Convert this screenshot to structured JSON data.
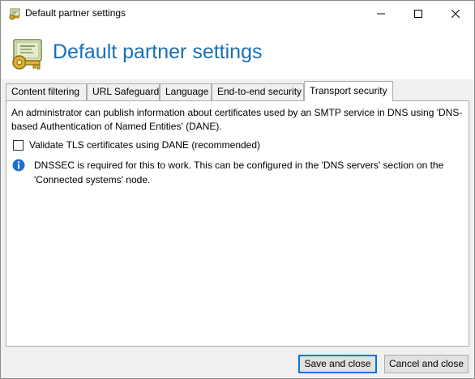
{
  "window": {
    "title": "Default partner settings"
  },
  "header": {
    "title": "Default partner settings"
  },
  "tabs": [
    {
      "label": "Content filtering",
      "active": false
    },
    {
      "label": "URL Safeguard",
      "active": false
    },
    {
      "label": "Language",
      "active": false
    },
    {
      "label": "End-to-end security",
      "active": false
    },
    {
      "label": "Transport security",
      "active": true
    }
  ],
  "transport_security": {
    "description": "An administrator can publish information about certificates used by an SMTP service in DNS using 'DNS-based Authentication of Named Entities' (DANE).",
    "dane_checkbox_label": "Validate TLS certificates using DANE (recommended)",
    "dane_checked": false,
    "info_text": "DNSSEC is required for this to work. This can be configured in the 'DNS servers' section on the 'Connected systems' node."
  },
  "buttons": {
    "save_label": "Save and close",
    "cancel_label": "Cancel and close"
  },
  "colors": {
    "header_title": "#1a6fb3",
    "default_button_border": "#0078d7",
    "info_icon": "#1f6fd1"
  },
  "icons": {
    "title_icon": "certificate-key-icon",
    "header_icon": "certificate-key-icon",
    "info_icon": "info-icon"
  }
}
